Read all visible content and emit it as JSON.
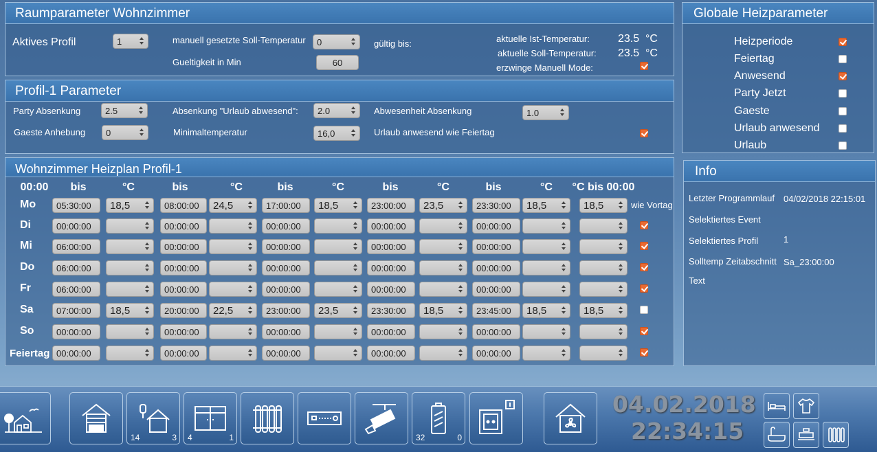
{
  "raum": {
    "title": "Raumparameter Wohnzimmer",
    "aktives_profil_label": "Aktives Profil",
    "aktives_profil_value": "1",
    "manuell_label": "manuell gesetzte Soll-Temperatur",
    "manuell_value": "0",
    "gueltigkeit_label": "Gueltigkeit in Min",
    "gueltigkeit_value": "60",
    "gueltig_bis_label": "gültig bis:",
    "ist_label": "aktuelle Ist-Temperatur:",
    "ist_value": "23.5",
    "soll_label": "aktuelle Soll-Temperatur:",
    "soll_value": "23.5",
    "unit": "°C",
    "erzwinge_label": "erzwinge Manuell Mode:",
    "erzwinge_checked": true
  },
  "profil": {
    "title": "Profil-1 Parameter",
    "party_label": "Party Absenkung",
    "party_value": "2.5",
    "urlaub_label": "Absenkung \"Urlaub abwesend\":",
    "urlaub_value": "2.0",
    "abwesenheit_label": "Abwesenheit Absenkung",
    "abwesenheit_value": "1.0",
    "gaeste_label": "Gaeste Anhebung",
    "gaeste_value": "0",
    "minimal_label": "Minimaltemperatur",
    "minimal_value": "16,0",
    "urlaub_feiertag_label": "Urlaub anwesend wie Feiertag",
    "urlaub_feiertag_checked": true
  },
  "global": {
    "title": "Globale Heizparameter",
    "items": [
      {
        "label": "Heizperiode",
        "checked": true
      },
      {
        "label": "Feiertag",
        "checked": false
      },
      {
        "label": "Anwesend",
        "checked": true
      },
      {
        "label": "Party Jetzt",
        "checked": false
      },
      {
        "label": "Gaeste",
        "checked": false
      },
      {
        "label": "Urlaub anwesend",
        "checked": false
      },
      {
        "label": "Urlaub",
        "checked": false
      }
    ]
  },
  "info": {
    "title": "Info",
    "letzter_label": "Letzter Programmlauf",
    "letzter_value": "04/02/2018 22:15:01",
    "event_label": "Selektiertes Event",
    "event_value": "",
    "profil_label": "Selektiertes Profil",
    "profil_value": "1",
    "solltemp_label": "Solltemp Zeitabschnitt",
    "solltemp_value": "Sa_23:00:00",
    "text_label": "Text"
  },
  "plan": {
    "title": "Wohnzimmer Heizplan Profil-1",
    "headers": [
      "00:00",
      "bis",
      "°C",
      "bis",
      "°C",
      "bis",
      "°C",
      "bis",
      "°C",
      "bis",
      "°C",
      "°C bis 00:00"
    ],
    "wie_vortag_label": "wie Vortag",
    "rows": [
      {
        "day": "Mo",
        "cells": [
          "05:30:00",
          "18,5",
          "08:00:00",
          "24,5",
          "17:00:00",
          "18,5",
          "23:00:00",
          "23,5",
          "23:30:00",
          "18,5",
          "18,5"
        ],
        "wie_vortag": null
      },
      {
        "day": "Di",
        "cells": [
          "00:00:00",
          "",
          "00:00:00",
          "",
          "00:00:00",
          "",
          "00:00:00",
          "",
          "00:00:00",
          "",
          ""
        ],
        "wie_vortag": true
      },
      {
        "day": "Mi",
        "cells": [
          "06:00:00",
          "",
          "00:00:00",
          "",
          "00:00:00",
          "",
          "00:00:00",
          "",
          "00:00:00",
          "",
          ""
        ],
        "wie_vortag": true
      },
      {
        "day": "Do",
        "cells": [
          "06:00:00",
          "",
          "00:00:00",
          "",
          "00:00:00",
          "",
          "00:00:00",
          "",
          "00:00:00",
          "",
          ""
        ],
        "wie_vortag": true
      },
      {
        "day": "Fr",
        "cells": [
          "06:00:00",
          "",
          "00:00:00",
          "",
          "00:00:00",
          "",
          "00:00:00",
          "",
          "00:00:00",
          "",
          ""
        ],
        "wie_vortag": true
      },
      {
        "day": "Sa",
        "cells": [
          "07:00:00",
          "18,5",
          "20:00:00",
          "22,5",
          "23:00:00",
          "23,5",
          "23:30:00",
          "18,5",
          "23:45:00",
          "18,5",
          "18,5"
        ],
        "wie_vortag": false
      },
      {
        "day": "So",
        "cells": [
          "00:00:00",
          "",
          "00:00:00",
          "",
          "00:00:00",
          "",
          "00:00:00",
          "",
          "00:00:00",
          "",
          ""
        ],
        "wie_vortag": true
      },
      {
        "day": "Feiertag",
        "cells": [
          "00:00:00",
          "",
          "00:00:00",
          "",
          "00:00:00",
          "",
          "00:00:00",
          "",
          "00:00:00",
          "",
          ""
        ],
        "wie_vortag": true
      }
    ]
  },
  "bottom": {
    "tiles": [
      {
        "name": "garden-house-icon",
        "left": "",
        "right": ""
      },
      {
        "name": "house-shutter-icon",
        "left": "",
        "right": ""
      },
      {
        "name": "house-lamp-icon",
        "left": "14",
        "right": "3"
      },
      {
        "name": "window-icon",
        "left": "4",
        "right": "1"
      },
      {
        "name": "radiator-icon",
        "left": "",
        "right": ""
      },
      {
        "name": "receiver-icon",
        "left": "",
        "right": ""
      },
      {
        "name": "camera-icon",
        "left": "",
        "right": ""
      },
      {
        "name": "battery-icon",
        "left": "32",
        "right": "0"
      },
      {
        "name": "socket-icon",
        "left": "",
        "right": ""
      },
      {
        "name": "house-fan-icon",
        "left": "",
        "right": ""
      }
    ],
    "date": "04.02.2018",
    "time": "22:34:15"
  }
}
